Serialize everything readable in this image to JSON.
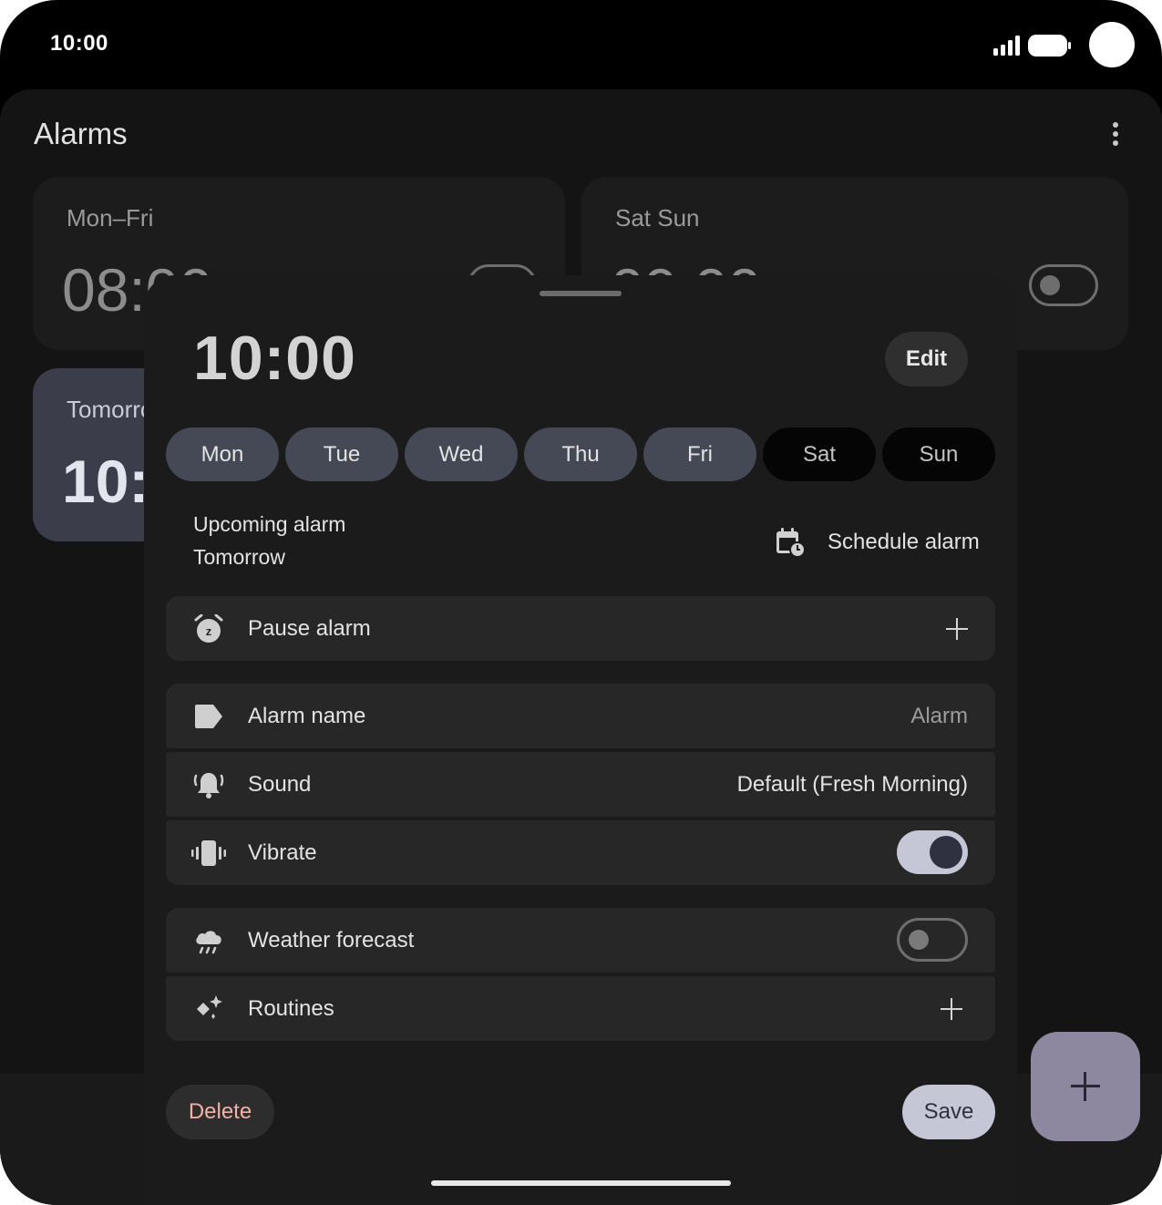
{
  "status_bar": {
    "time": "10:00"
  },
  "app": {
    "title": "Alarms"
  },
  "background_alarms": [
    {
      "days": "Mon–Fri",
      "time": "08:00"
    },
    {
      "days": "Sat Sun",
      "time": "09:00"
    },
    {
      "days": "Tomorrow",
      "time": "10:00"
    }
  ],
  "sheet": {
    "time": "10:00",
    "edit_label": "Edit",
    "days": [
      {
        "label": "Mon",
        "selected": true
      },
      {
        "label": "Tue",
        "selected": true
      },
      {
        "label": "Wed",
        "selected": true
      },
      {
        "label": "Thu",
        "selected": true
      },
      {
        "label": "Fri",
        "selected": true
      },
      {
        "label": "Sat",
        "selected": false
      },
      {
        "label": "Sun",
        "selected": false
      }
    ],
    "upcoming_label": "Upcoming alarm",
    "upcoming_value": "Tomorrow",
    "schedule_label": "Schedule alarm",
    "pause_label": "Pause alarm",
    "name_label": "Alarm name",
    "name_value": "Alarm",
    "sound_label": "Sound",
    "sound_value": "Default (Fresh Morning)",
    "vibrate_label": "Vibrate",
    "vibrate_on": true,
    "weather_label": "Weather forecast",
    "weather_on": false,
    "routines_label": "Routines",
    "delete_label": "Delete",
    "save_label": "Save"
  },
  "colors": {
    "day_selected": "#454956",
    "toggle_on": "#c5c7d7",
    "delete_text": "#f2b0a6",
    "fab": "#8d889f"
  }
}
